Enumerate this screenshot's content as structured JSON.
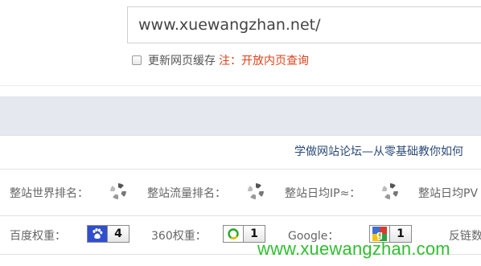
{
  "url_input": {
    "value": "www.xuewangzhan.net/"
  },
  "options": {
    "refresh_cache_label": "更新网页缓存",
    "note": "注：开放内页查询"
  },
  "site_title": "学做网站论坛—从零基础教你如何",
  "rank_row": {
    "world_rank_label": "整站世界排名：",
    "traffic_rank_label": "整站流量排名：",
    "daily_ip_label": "整站日均IP≈：",
    "daily_pv_label": "整站日均PV"
  },
  "weight_row": {
    "baidu_label": "百度权重：",
    "baidu_value": "4",
    "w360_label": "360权重：",
    "w360_value": "1",
    "google_label": "Google：",
    "google_value": "1",
    "backlink_label": "反链数"
  },
  "watermark": "www.xuewangzhan.com",
  "colors": {
    "note": "#e0401a",
    "title": "#2b4a77",
    "band": "#e5e8ef",
    "watermark": "#2fbf2f"
  }
}
